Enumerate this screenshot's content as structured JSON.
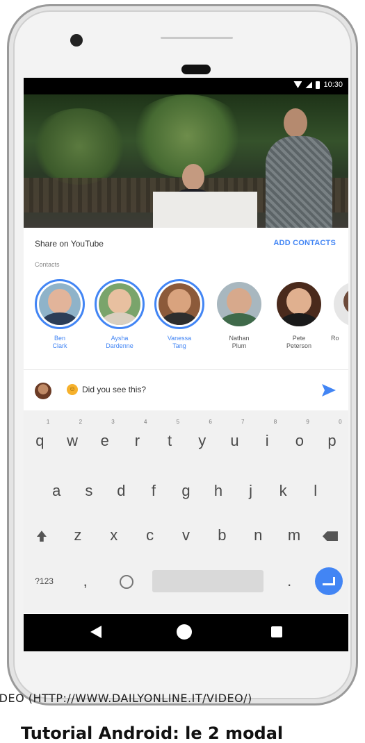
{
  "status_bar": {
    "time": "10:30"
  },
  "share_sheet": {
    "title": "Share on YouTube",
    "add_contacts_label": "ADD CONTACTS",
    "contacts_label": "Contacts"
  },
  "contacts": [
    {
      "name_line1": "Ben",
      "name_line2": "Clark",
      "selected": true
    },
    {
      "name_line1": "Aysha",
      "name_line2": "Dardenne",
      "selected": true
    },
    {
      "name_line1": "Vanessa",
      "name_line2": "Tang",
      "selected": true
    },
    {
      "name_line1": "Nathan",
      "name_line2": "Plum",
      "selected": false
    },
    {
      "name_line1": "Pete",
      "name_line2": "Peterson",
      "selected": false
    },
    {
      "name_line1": "Ro",
      "name_line2": "",
      "selected": false
    }
  ],
  "compose": {
    "message": "Did you see this?"
  },
  "keyboard": {
    "row1": [
      {
        "key": "q",
        "hint": "1"
      },
      {
        "key": "w",
        "hint": "2"
      },
      {
        "key": "e",
        "hint": "3"
      },
      {
        "key": "r",
        "hint": "4"
      },
      {
        "key": "t",
        "hint": "5"
      },
      {
        "key": "y",
        "hint": "6"
      },
      {
        "key": "u",
        "hint": "7"
      },
      {
        "key": "i",
        "hint": "8"
      },
      {
        "key": "o",
        "hint": "9"
      },
      {
        "key": "p",
        "hint": "0"
      }
    ],
    "row2": [
      "a",
      "s",
      "d",
      "f",
      "g",
      "h",
      "j",
      "k",
      "l"
    ],
    "row3": [
      "z",
      "x",
      "c",
      "v",
      "b",
      "n",
      "m"
    ],
    "symbols_label": "?123",
    "comma": ",",
    "period": "."
  },
  "caption": {
    "source": "VIDEO (HTTP://WWW.DAILYONLINE.IT/VIDEO/)",
    "title": "Tutorial Android: le 2 modal"
  },
  "colors": {
    "accent": "#4285f4",
    "keyboard_bg": "#f1f1f1"
  },
  "icons": {
    "send": "send-icon",
    "back": "back-icon",
    "home": "home-icon",
    "recents": "recents-icon",
    "shift": "shift-icon",
    "backspace": "backspace-icon"
  }
}
